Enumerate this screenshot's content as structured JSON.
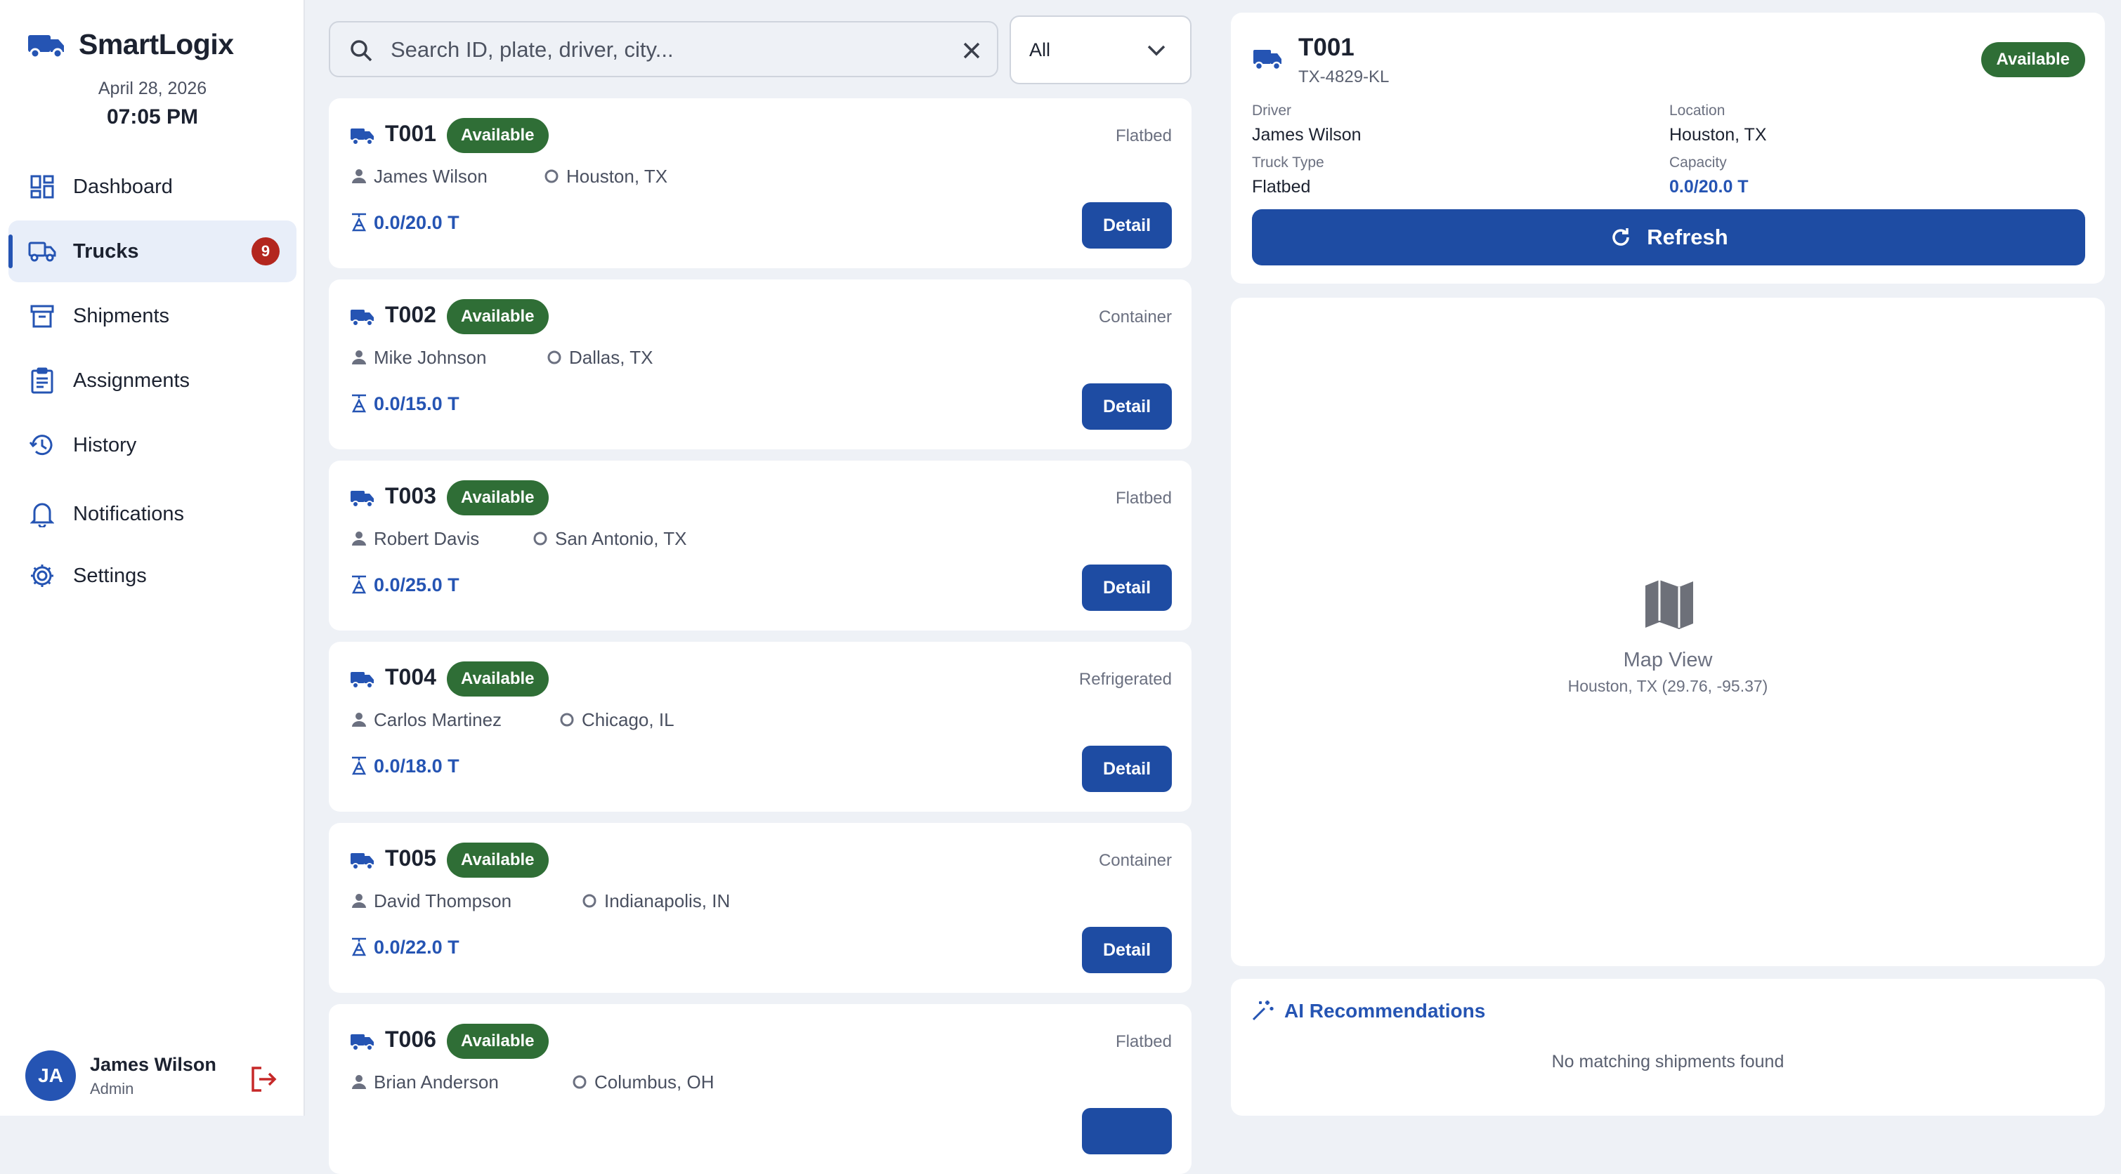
{
  "app": {
    "name": "SmartLogix",
    "date": "April 28, 2026",
    "time": "07:05 PM"
  },
  "colors": {
    "primary": "#2554b3",
    "status_available": "#2f6e36",
    "badge": "#b3261e"
  },
  "sidebar": {
    "items": [
      {
        "label": "Dashboard",
        "icon": "dashboard-icon"
      },
      {
        "label": "Trucks",
        "icon": "truck-icon",
        "badge": "9",
        "active": true
      },
      {
        "label": "Shipments",
        "icon": "archive-box-icon"
      },
      {
        "label": "Assignments",
        "icon": "clipboard-icon"
      },
      {
        "label": "History",
        "icon": "history-icon"
      },
      {
        "label": "Notifications",
        "icon": "bell-icon"
      },
      {
        "label": "Settings",
        "icon": "gear-icon"
      }
    ]
  },
  "user": {
    "initials": "JA",
    "name": "James Wilson",
    "role": "Admin"
  },
  "search": {
    "placeholder": "Search ID, plate, driver, city...",
    "value": ""
  },
  "filter": {
    "value": "All"
  },
  "trucks": [
    {
      "id": "T001",
      "status": "Available",
      "type": "Flatbed",
      "driver": "James Wilson",
      "location": "Houston, TX",
      "capacity": "0.0/20.0 T",
      "detail_label": "Detail"
    },
    {
      "id": "T002",
      "status": "Available",
      "type": "Container",
      "driver": "Mike Johnson",
      "location": "Dallas, TX",
      "capacity": "0.0/15.0 T",
      "detail_label": "Detail"
    },
    {
      "id": "T003",
      "status": "Available",
      "type": "Flatbed",
      "driver": "Robert Davis",
      "location": "San Antonio, TX",
      "capacity": "0.0/25.0 T",
      "detail_label": "Detail"
    },
    {
      "id": "T004",
      "status": "Available",
      "type": "Refrigerated",
      "driver": "Carlos Martinez",
      "location": "Chicago, IL",
      "capacity": "0.0/18.0 T",
      "detail_label": "Detail"
    },
    {
      "id": "T005",
      "status": "Available",
      "type": "Container",
      "driver": "David Thompson",
      "location": "Indianapolis, IN",
      "capacity": "0.0/22.0 T",
      "detail_label": "Detail"
    },
    {
      "id": "T006",
      "status": "Available",
      "type": "Flatbed",
      "driver": "Brian Anderson",
      "location": "Columbus, OH",
      "capacity": "",
      "detail_label": ""
    }
  ],
  "selected": {
    "id": "T001",
    "plate": "TX-4829-KL",
    "status": "Available",
    "driver_label": "Driver",
    "driver": "James Wilson",
    "location_label": "Location",
    "location": "Houston, TX",
    "type_label": "Truck Type",
    "type": "Flatbed",
    "capacity_label": "Capacity",
    "capacity": "0.0/20.0 T",
    "refresh_label": "Refresh"
  },
  "map": {
    "title": "Map View",
    "coords": "Houston, TX (29.76, -95.37)"
  },
  "ai": {
    "title": "AI Recommendations",
    "empty": "No matching shipments found"
  }
}
